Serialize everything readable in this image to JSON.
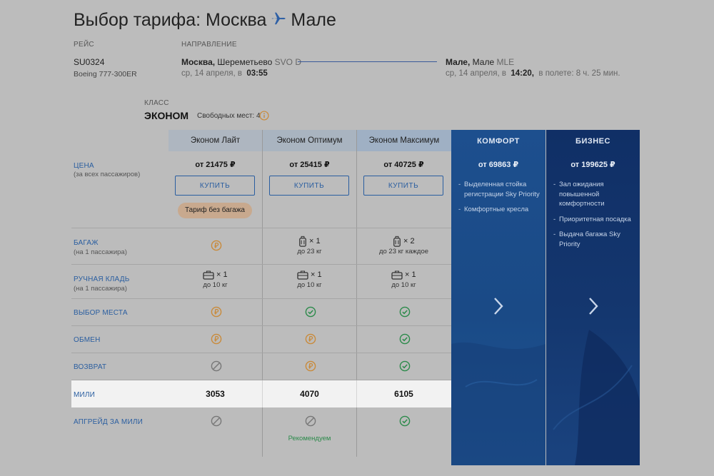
{
  "page": {
    "title_prefix": "Выбор тарифа: Москва",
    "title_suffix": "Мале"
  },
  "flight": {
    "label": "РЕЙС",
    "number": "SU0324",
    "aircraft": "Boeing 777-300ER"
  },
  "direction": {
    "label": "НАПРАВЛЕНИЕ",
    "from_city": "Москва,",
    "from_airport": "Шереметьево",
    "from_code": "SVO D",
    "from_date": "ср, 14 апреля, в",
    "from_time": "03:55",
    "to_city": "Мале,",
    "to_airport": "Мале",
    "to_code": "MLE",
    "to_date": "ср, 14 апреля, в",
    "to_time": "14:20,",
    "duration": "в полете: 8 ч. 25 мин."
  },
  "class_info": {
    "label": "КЛАСС",
    "name": "ЭКОНОМ",
    "seats": "Свободных мест: 4"
  },
  "tariffs": [
    {
      "name": "Эконом Лайт",
      "price": "от 21475 ₽",
      "buy": "КУПИТЬ",
      "tag": "Тариф без багажа",
      "miles": "3053"
    },
    {
      "name": "Эконом Оптимум",
      "price": "от 25415 ₽",
      "buy": "КУПИТЬ",
      "miles": "4070"
    },
    {
      "name": "Эконом Максимум",
      "price": "от 40725 ₽",
      "buy": "КУПИТЬ",
      "miles": "6105"
    }
  ],
  "rows": {
    "price": {
      "label": "ЦЕНА",
      "sub": "(за всех пассажиров)"
    },
    "baggage": {
      "label": "БАГАЖ",
      "sub": "(на 1 пассажира)"
    },
    "hand": {
      "label": "РУЧНАЯ КЛАДЬ",
      "sub": "(на 1 пассажира)"
    },
    "seat": {
      "label": "ВЫБОР МЕСТА"
    },
    "exchange": {
      "label": "ОБМЕН"
    },
    "refund": {
      "label": "ВОЗВРАТ"
    },
    "miles": {
      "label": "МИЛИ"
    },
    "upgrade": {
      "label": "АПГРЕЙД ЗА МИЛИ"
    }
  },
  "baggage": {
    "optimum_qty": "× 1",
    "optimum_weight": "до 23 кг",
    "maximum_qty": "× 2",
    "maximum_weight": "до 23 кг каждое"
  },
  "hand": {
    "qty": "× 1",
    "weight": "до 10 кг"
  },
  "upgrade_recommend": "Рекомендуем",
  "comfort": {
    "title": "КОМФОРТ",
    "price": "от 69863 ₽",
    "features": [
      "Выделенная стойка регистрации Sky Priority",
      "Комфортные кресла"
    ]
  },
  "business": {
    "title": "БИЗНЕС",
    "price": "от 199625 ₽",
    "features": [
      "Зал ожидания повышенной комфортности",
      "Приоритетная посадка",
      "Выдача багажа Sky Priority"
    ]
  },
  "colors": {
    "accent": "#2a5ea0",
    "fee": "#c98a3a",
    "included": "#2b8a4a",
    "not_available": "#7a7a7a",
    "comfort_bg": "#1d4f8e",
    "business_bg": "#102f66"
  },
  "icons": {
    "fee": "ruble-coin-icon",
    "included": "check-circle-icon",
    "not_available": "prohibited-icon",
    "baggage": "suitcase-icon",
    "hand": "briefcase-icon",
    "info": "info-icon",
    "next": "chevron-right-icon",
    "plane": "plane-icon"
  }
}
